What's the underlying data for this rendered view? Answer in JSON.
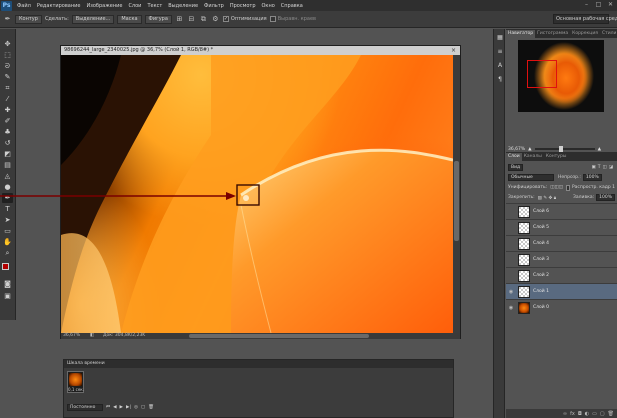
{
  "app": {
    "logo": "Ps"
  },
  "menu": [
    "Файл",
    "Редактирование",
    "Изображение",
    "Слои",
    "Текст",
    "Выделение",
    "Фильтр",
    "Просмотр",
    "Окно",
    "Справка"
  ],
  "window_buttons": [
    "–",
    "□",
    "✕"
  ],
  "options": {
    "tool_mode": "Контур",
    "make_label": "Сделать:",
    "selection_btn": "Выделение...",
    "mask_btn": "Маска",
    "shape_btn": "Фигура",
    "auto_align_label": "Оптимизация",
    "align_edges_label": "Выравн. краев",
    "workspace": "Основная рабочая среда"
  },
  "document": {
    "tab_title": "98696244_large_2340025.jpg @ 36,7% (Слой 1, RGB/8#) *",
    "close": "×",
    "zoom": "36,67%",
    "doc_size": "Док: 304,8K/2,23K"
  },
  "navigator": {
    "tabs": [
      "Навигатор",
      "Гистограмма",
      "Коррекция",
      "Стили"
    ],
    "zoom_value": "36,67%"
  },
  "layers": {
    "tabs": [
      "Слои",
      "Каналы",
      "Контуры"
    ],
    "kind_label": "Вид",
    "blend_mode": "Обычные",
    "opacity_label": "Непрозр.:",
    "opacity_value": "100%",
    "lock_label": "Унифицировать:",
    "propagate_label": "Распростр. кадр 1",
    "locks_label": "Закрепить:",
    "fill_label": "Заливка:",
    "fill_value": "100%",
    "items": [
      {
        "name": "Слой 6",
        "visible": false,
        "selected": false,
        "image": false
      },
      {
        "name": "Слой 5",
        "visible": false,
        "selected": false,
        "image": false
      },
      {
        "name": "Слой 4",
        "visible": false,
        "selected": false,
        "image": false
      },
      {
        "name": "Слой 3",
        "visible": false,
        "selected": false,
        "image": false
      },
      {
        "name": "Слой 2",
        "visible": false,
        "selected": false,
        "image": false
      },
      {
        "name": "Слой 1",
        "visible": true,
        "selected": true,
        "image": false
      },
      {
        "name": "Слой 0",
        "visible": true,
        "selected": false,
        "image": true
      }
    ]
  },
  "timeline": {
    "title": "Шкала времени",
    "frame_time": "0,1 сек.",
    "loop": "Постоянно"
  }
}
